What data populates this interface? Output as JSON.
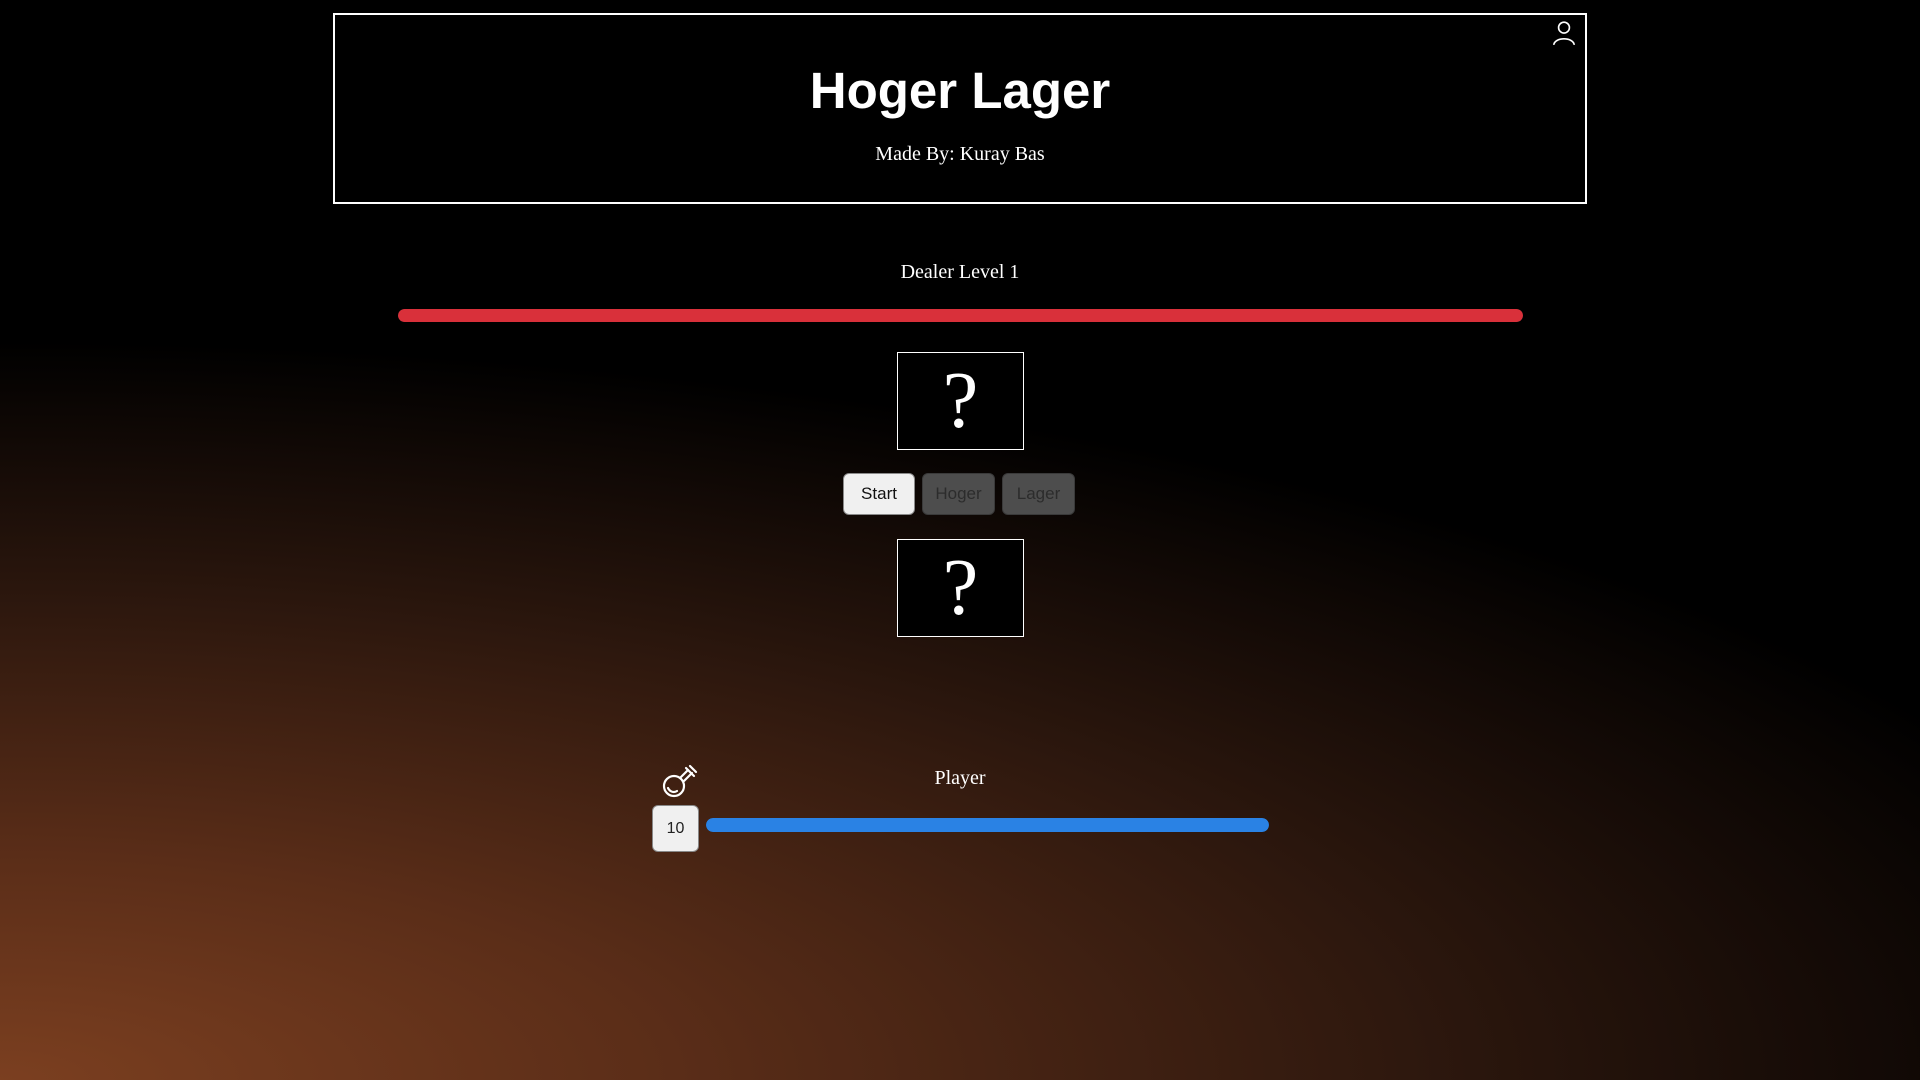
{
  "header": {
    "title": "Hoger Lager",
    "subtitle": "Made By: Kuray Bas",
    "profile_icon": "user-icon"
  },
  "dealer": {
    "label": "Dealer Level 1",
    "health_fraction": 1.0,
    "health_color": "#d9303a"
  },
  "cards": {
    "top": "?",
    "bottom": "?"
  },
  "controls": {
    "start_label": "Start",
    "higher_label": "Hoger",
    "lower_label": "Lager",
    "higher_enabled": false,
    "lower_enabled": false
  },
  "player": {
    "label": "Player",
    "potion_icon": "potion-icon",
    "potion_count": "10",
    "health_fraction": 1.0,
    "health_color": "#2a82e4"
  }
}
